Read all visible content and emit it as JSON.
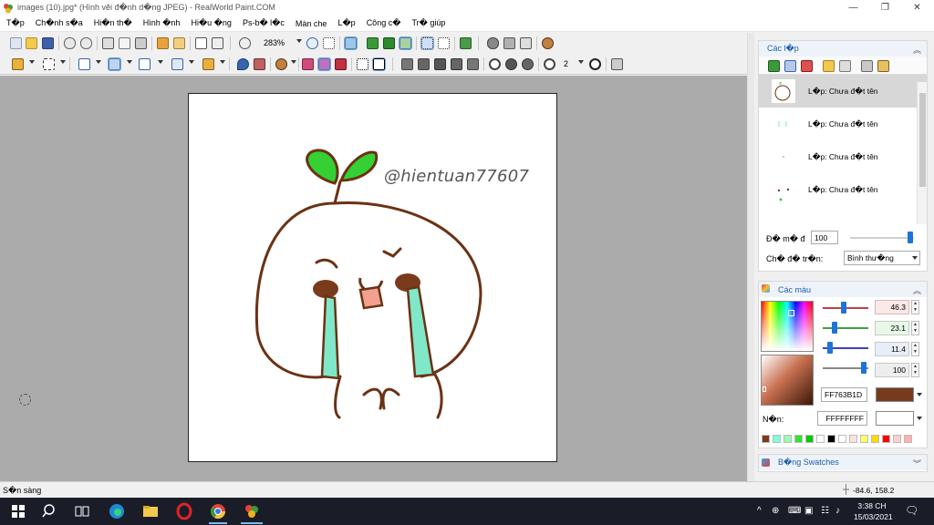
{
  "window": {
    "title": "images (10).jpg* (Hình vẽi đ�nh d�ng JPEG) - RealWorld Paint.COM",
    "controls": {
      "minimize": "—",
      "maximize": "❐",
      "close": "✕"
    }
  },
  "menu": {
    "items": [
      "T�p",
      "Ch�nh s�a",
      "Hi�n th�",
      "Hình �nh",
      "Hi�u �ng",
      "Ps-b� l�c",
      "Màn che",
      "L�p",
      "Công c�",
      "Tr� giúp"
    ]
  },
  "toolbar": {
    "zoom": "283%",
    "brush_size": "2"
  },
  "canvas": {
    "watermark": "@hientuan77607"
  },
  "layers_panel": {
    "title": "Các l�p",
    "layers": [
      {
        "name": "L�p: Chưa đ�t tên",
        "selected": true
      },
      {
        "name": "L�p: Chưa đ�t tên",
        "selected": false
      },
      {
        "name": "L�p: Chưa đ�t tên",
        "selected": false
      },
      {
        "name": "L�p: Chưa đ�t tên",
        "selected": false
      }
    ],
    "opacity_label": "Đ� m� đ",
    "opacity_value": "100",
    "blend_label": "Ch� đ� tr�n:",
    "blend_value": "Bình thư�ng"
  },
  "colors_panel": {
    "title": "Các màu",
    "slider_values": [
      "46.3",
      "23.1",
      "11.4",
      "100"
    ],
    "primary_hex": "FF763B1D",
    "primary_color": "#763B1D",
    "secondary_label": "N�n:",
    "secondary_hex": "FFFFFFFF",
    "secondary_color": "#FFFFFF",
    "swatches": [
      "#7a3b1d",
      "#7fffd4",
      "#98ffb0",
      "#34e034",
      "#00c800",
      "#ffffff",
      "#000000",
      "#ffffff",
      "#ffe0e0",
      "#ffff66",
      "#ffd800",
      "#ff0000",
      "#ffd0d0",
      "#ffb0b0"
    ]
  },
  "swatches_panel": {
    "title": "B�ng Swatches"
  },
  "status": {
    "text": "S�n sàng",
    "coords": "-84.6, 158.2"
  },
  "taskbar": {
    "time": "3:38 CH",
    "date": "15/03/2021"
  }
}
